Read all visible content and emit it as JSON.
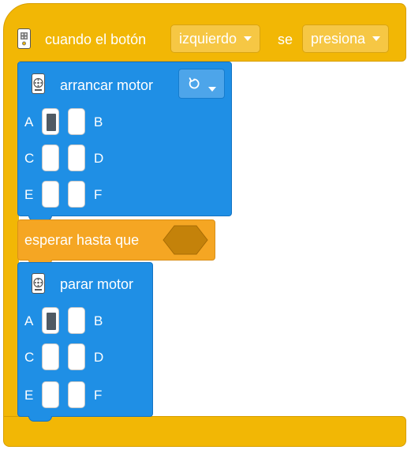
{
  "hat": {
    "label_when": "cuando el botón",
    "button_value": "izquierdo",
    "label_se": "se",
    "action_value": "presiona"
  },
  "start_motor": {
    "title": "arrancar motor",
    "direction_icon": "rotate-ccw-icon",
    "ports": {
      "A": "A",
      "B": "B",
      "C": "C",
      "D": "D",
      "E": "E",
      "F": "F"
    },
    "selected_port": "A"
  },
  "wait": {
    "label": "esperar hasta que"
  },
  "stop_motor": {
    "title": "parar motor",
    "ports": {
      "A": "A",
      "B": "B",
      "C": "C",
      "D": "D",
      "E": "E",
      "F": "F"
    },
    "selected_port": "A"
  },
  "colors": {
    "events_yellow": "#f2b705",
    "motor_blue": "#1f8fe5",
    "control_orange": "#f5a623",
    "boolean_slot": "#c4820a"
  }
}
